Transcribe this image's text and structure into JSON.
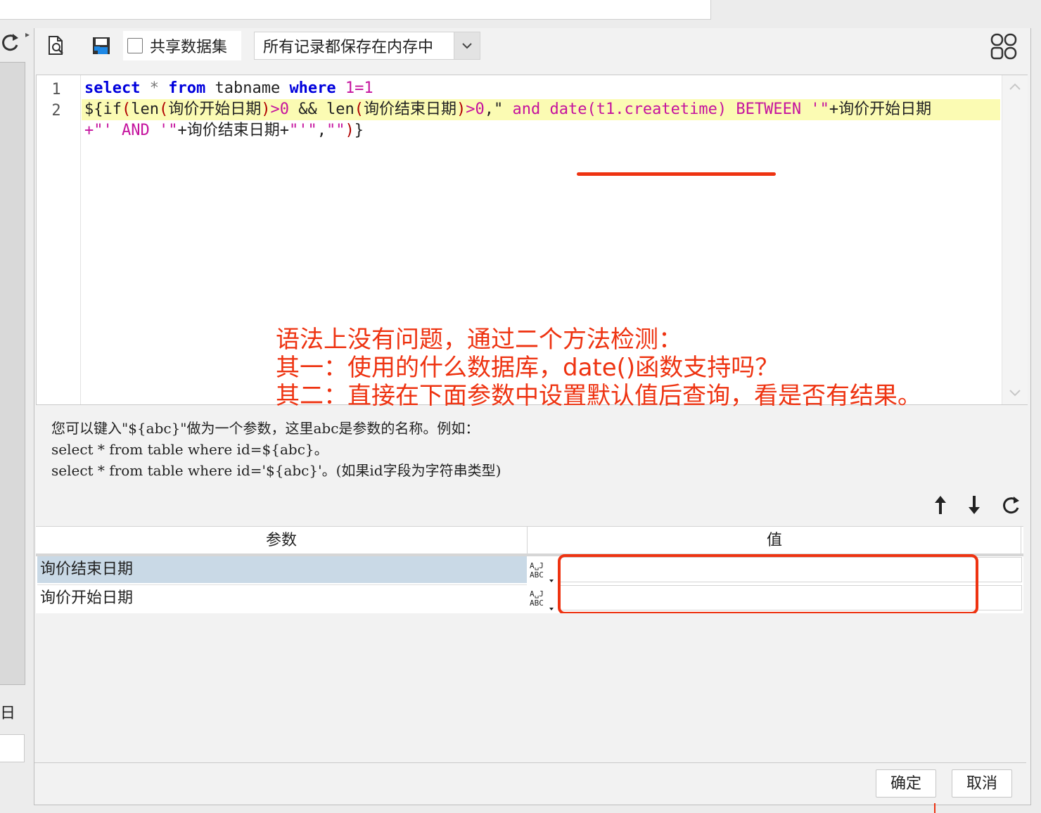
{
  "toolbar": {
    "share_dataset_label": "共享数据集",
    "share_dataset_checked": false,
    "memory_mode_value": "所有记录都保存在内存中",
    "icons": [
      "refresh-icon",
      "preview-icon",
      "save-icon",
      "layout-grid-icon",
      "chevron-down-icon"
    ]
  },
  "editor": {
    "line_numbers": [
      "1",
      "2"
    ],
    "line1": {
      "select": "select",
      "star": "*",
      "from": "from",
      "table": "tabname",
      "where": "where",
      "cond": "1=1"
    },
    "line2a": {
      "t1": "${if",
      "t2": "(",
      "t3": "len",
      "t4": "(",
      "t5": "询价开始日期",
      "t6": ")",
      "t7": ">0",
      "t8": " && ",
      "t9": "len",
      "t10": "(",
      "t11": "询价结束日期",
      "t12": ")",
      "t13": ">0",
      "t14": ",\"",
      "t15": " and ",
      "t16": "date(t1.createtime)",
      "t17": " BETWEEN ",
      "t18": "'\"",
      "t19": "+询价开始日期"
    },
    "line2b": {
      "t1": "+\"'",
      "t2": " AND ",
      "t3": "'\"",
      "t4": "+询价结束日期+",
      "t5": "\"'\"",
      "t6": ",",
      "t7": "\"\"",
      "t8": ")",
      "t9": "}"
    },
    "annotation": {
      "line1": "语法上没有问题，通过二个方法检测：",
      "line2": "其一：使用的什么数据库，date()函数支持吗？",
      "line3": "其二：直接在下面参数中设置默认值后查询，看是否有结果。"
    }
  },
  "hint": {
    "line1": "您可以键入\"${abc}\"做为一个参数，这里abc是参数的名称。例如：",
    "line2": "select * from table where id=${abc}。",
    "line3": "select * from table where id='${abc}'。(如果id字段为字符串类型)"
  },
  "params_table": {
    "header_param": "参数",
    "header_value": "值",
    "rows": [
      {
        "name": "询价结束日期",
        "value": "",
        "type_icon": "abc-type-icon"
      },
      {
        "name": "询价开始日期",
        "value": "",
        "type_icon": "abc-type-icon"
      }
    ]
  },
  "buttons": {
    "ok": "确定",
    "cancel": "取消"
  },
  "colors": {
    "annotation_red": "#ee3311",
    "keyword_blue": "#0000dd",
    "string_magenta": "#c5139e",
    "line_highlight": "#fbfbb3",
    "selected_row": "#c9d9e6"
  }
}
